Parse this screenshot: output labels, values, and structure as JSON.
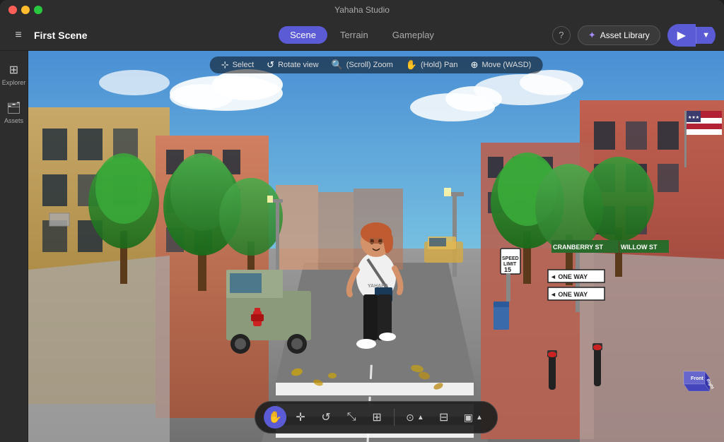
{
  "window": {
    "title": "Yahaha Studio",
    "controls": {
      "close": "●",
      "minimize": "●",
      "maximize": "●"
    }
  },
  "toolbar": {
    "menu_icon": "≡",
    "scene_title": "First Scene",
    "tabs": [
      {
        "id": "scene",
        "label": "Scene",
        "active": true
      },
      {
        "id": "terrain",
        "label": "Terrain",
        "active": false
      },
      {
        "id": "gameplay",
        "label": "Gameplay",
        "active": false
      }
    ],
    "help_label": "?",
    "asset_library_label": "Asset Library",
    "asset_library_icon": "✦",
    "play_icon": "▶",
    "dropdown_icon": "▼"
  },
  "sidebar": {
    "items": [
      {
        "id": "explorer",
        "label": "Explorer",
        "icon": "⊞"
      },
      {
        "id": "assets",
        "label": "Assets",
        "icon": "🗂"
      }
    ]
  },
  "viewport": {
    "tools": [
      {
        "id": "select",
        "icon": "⊹",
        "label": "Select"
      },
      {
        "id": "rotate",
        "icon": "↺",
        "label": "Rotate view"
      },
      {
        "id": "zoom",
        "icon": "⊕",
        "label": "(Scroll) Zoom"
      },
      {
        "id": "pan",
        "icon": "✋",
        "label": "(Hold) Pan"
      },
      {
        "id": "move",
        "icon": "⊕",
        "label": "Move (WASD)"
      }
    ]
  },
  "bottom_toolbar": {
    "tools": [
      {
        "id": "move-tool",
        "icon": "✋",
        "active": true
      },
      {
        "id": "translate",
        "icon": "✛",
        "active": false
      },
      {
        "id": "rotate-tool",
        "icon": "↺",
        "active": false
      },
      {
        "id": "scale",
        "icon": "⤡",
        "active": false
      },
      {
        "id": "transform",
        "icon": "⊞",
        "active": false
      }
    ],
    "right_tools": [
      {
        "id": "object-opts",
        "icon": "⊞",
        "active": false
      },
      {
        "id": "grid",
        "icon": "⊟",
        "active": false
      },
      {
        "id": "camera",
        "icon": "▣",
        "active": false
      }
    ]
  },
  "scene": {
    "street_signs": [
      "CRANBERRY ST",
      "WILLOW ST"
    ],
    "one_way": "ONE WAY"
  },
  "gizmo": {
    "front_label": "Front",
    "right_label": "Right"
  },
  "colors": {
    "accent": "#5b5bd6",
    "active_bg": "#5b5bd6",
    "toolbar_bg": "#2d2d2d",
    "sidebar_bg": "#2d2d2d"
  }
}
